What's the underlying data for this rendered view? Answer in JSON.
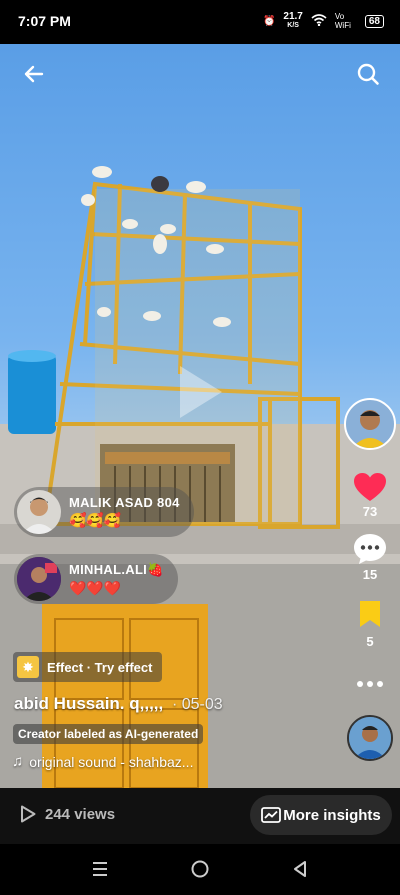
{
  "status": {
    "time": "7:07 PM",
    "speed_top": "21.7",
    "speed_unit": "K/S",
    "network": "Vo WiFi",
    "battery": "68"
  },
  "comments": [
    {
      "name": "MALIK ASAD 804",
      "text": "🥰🥰🥰"
    },
    {
      "name": "MINHAL.ALI🍓",
      "text": "❤️❤️❤️"
    }
  ],
  "actions": {
    "likes": "73",
    "comments": "15",
    "saves": "5"
  },
  "effect": {
    "label": "Effect · Try effect"
  },
  "post": {
    "author": "abid Hussain. q,,,,,",
    "date": "· 05-03",
    "ai_label": "Creator labeled as AI-generated",
    "sound": "original sound - shahbaz..."
  },
  "bottom": {
    "views": "244 views",
    "insights": "More insights"
  },
  "icons": {
    "back": "back-arrow-icon",
    "search": "search-icon",
    "heart": "heart-icon",
    "comment": "comment-icon",
    "bookmark": "bookmark-icon",
    "more": "more-icon",
    "music": "music-note-icon",
    "play": "play-icon",
    "insights": "insights-chart-icon"
  },
  "colors": {
    "heart": "#fe2c55",
    "bookmark": "#facc15"
  }
}
